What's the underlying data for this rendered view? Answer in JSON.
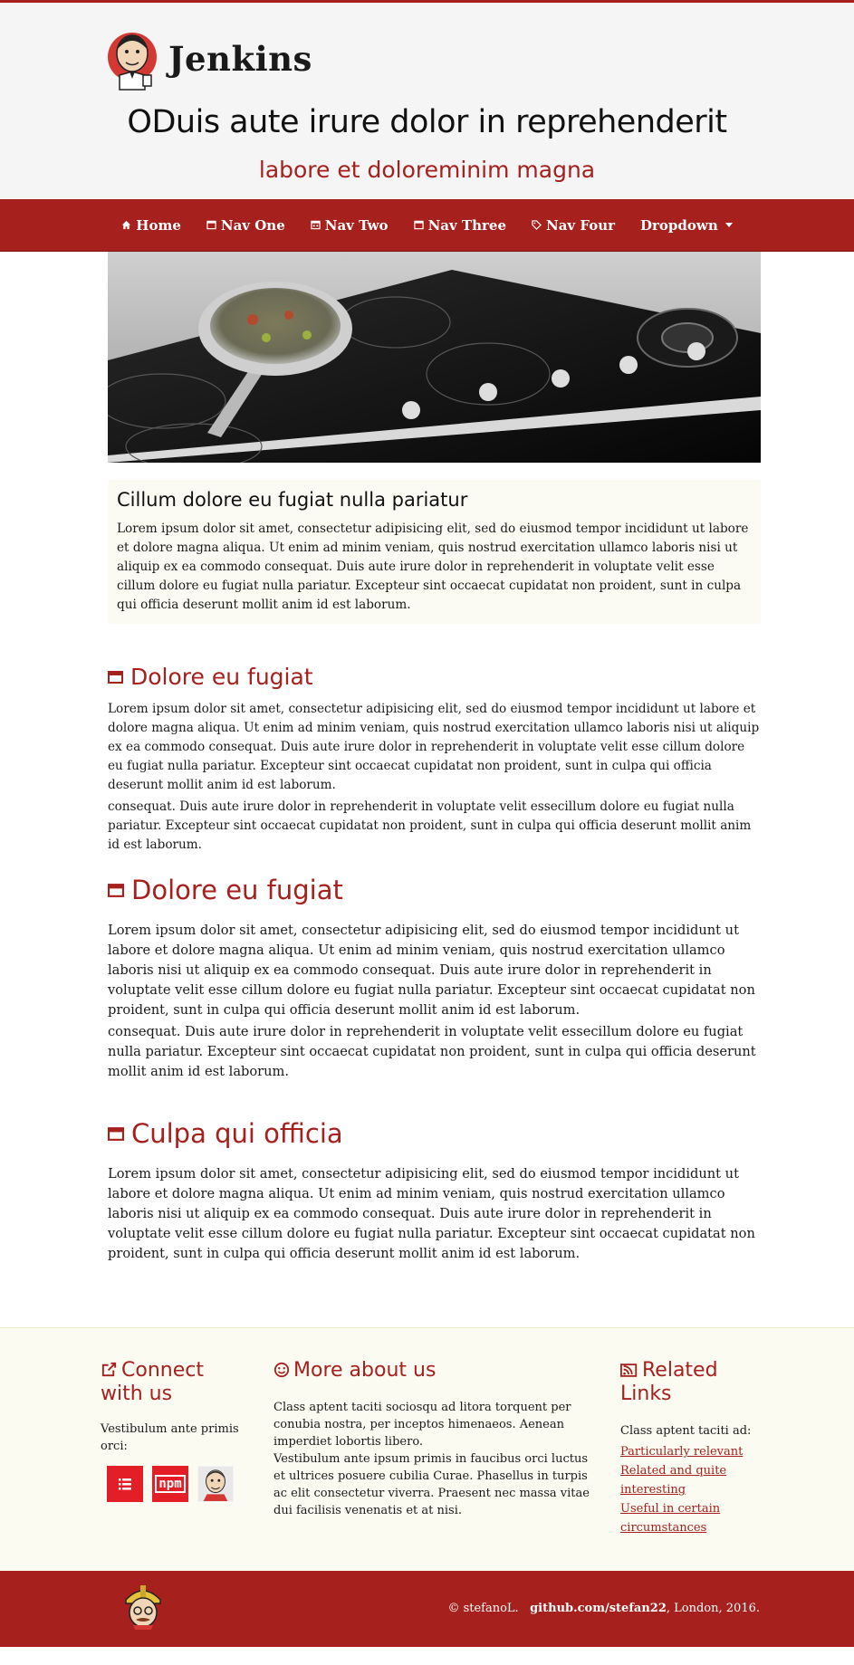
{
  "header": {
    "logo_text": "Jenkins",
    "title": "ODuis aute irure dolor in reprehenderit",
    "subtitle": "labore et doloreminim magna"
  },
  "nav": {
    "items": [
      {
        "label": "Home",
        "icon": "home-icon"
      },
      {
        "label": "Nav One",
        "icon": "window-icon"
      },
      {
        "label": "Nav Two",
        "icon": "calendar-icon"
      },
      {
        "label": "Nav Three",
        "icon": "window-icon"
      },
      {
        "label": "Nav Four",
        "icon": "tag-icon"
      },
      {
        "label": "Dropdown",
        "icon": "caret-down-icon"
      }
    ]
  },
  "intro": {
    "title": "Cillum dolore eu fugiat nulla pariatur",
    "text": "Lorem ipsum dolor sit amet, consectetur adipisicing elit, sed do eiusmod tempor incididunt ut labore et dolore magna aliqua. Ut enim ad minim veniam, quis nostrud exercitation ullamco laboris nisi ut aliquip ex ea commodo consequat. Duis aute irure dolor in reprehenderit in voluptate velit esse cillum dolore eu fugiat nulla pariatur. Excepteur sint occaecat cupidatat non proident, sunt in culpa qui officia deserunt mollit anim id est laborum."
  },
  "sections": [
    {
      "heading": "Dolore eu fugiat",
      "p1": "Lorem ipsum dolor sit amet, consectetur adipisicing elit, sed do eiusmod tempor incididunt ut labore et dolore magna aliqua. Ut enim ad minim veniam, quis nostrud exercitation ullamco laboris nisi ut aliquip ex ea commodo consequat. Duis aute irure dolor in reprehenderit in voluptate velit esse cillum dolore eu fugiat nulla pariatur. Excepteur sint occaecat cupidatat non proident, sunt in culpa qui officia deserunt mollit anim id est laborum.",
      "p2": "consequat. Duis aute irure dolor in reprehenderit in voluptate velit essecillum dolore eu fugiat nulla pariatur. Excepteur sint occaecat cupidatat non proident, sunt in culpa qui officia deserunt mollit anim id est laborum."
    },
    {
      "heading": "Dolore eu fugiat",
      "p1": "Lorem ipsum dolor sit amet, consectetur adipisicing elit, sed do eiusmod tempor incididunt ut labore et dolore magna aliqua. Ut enim ad minim veniam, quis nostrud exercitation ullamco laboris nisi ut aliquip ex ea commodo consequat. Duis aute irure dolor in reprehenderit in voluptate velit esse cillum dolore eu fugiat nulla pariatur. Excepteur sint occaecat cupidatat non proident, sunt in culpa qui officia deserunt mollit anim id est laborum.",
      "p2": "consequat. Duis aute irure dolor in reprehenderit in voluptate velit essecillum dolore eu fugiat nulla pariatur. Excepteur sint occaecat cupidatat non proident, sunt in culpa qui officia deserunt mollit anim id est laborum."
    },
    {
      "heading": "Culpa qui officia",
      "p1": "Lorem ipsum dolor sit amet, consectetur adipisicing elit, sed do eiusmod tempor incididunt ut labore et dolore magna aliqua. Ut enim ad minim veniam, quis nostrud exercitation ullamco laboris nisi ut aliquip ex ea commodo consequat. Duis aute irure dolor in reprehenderit in voluptate velit esse cillum dolore eu fugiat nulla pariatur. Excepteur sint occaecat cupidatat non proident, sunt in culpa qui officia deserunt mollit anim id est laborum."
    }
  ],
  "footer": {
    "connect": {
      "heading": "Connect with us",
      "text": "Vestibulum ante primis orci:",
      "icons": [
        "list-icon",
        "npm-icon",
        "jenkins-avatar-icon"
      ],
      "npm_label": "npm"
    },
    "about": {
      "heading": "More about us",
      "text1": "Class aptent taciti sociosqu ad litora torquent per conubia nostra, per inceptos himenaeos. Aenean imperdiet lobortis libero.",
      "text2": "Vestibulum ante ipsum primis in faucibus orci luctus et ultrices posuere cubilia Curae. Phasellus in turpis ac elit consectetur viverra. Praesent nec massa vitae dui facilisis venenatis et at nisi."
    },
    "related": {
      "heading": "Related Links",
      "text": "Class aptent taciti ad:",
      "links": [
        "Particularly relevant",
        "Related and quite interesting",
        "Useful in certain circumstances"
      ]
    }
  },
  "bottom": {
    "copyright_prefix": "© stefanoL.",
    "github_link": "github.com/stefan22",
    "copyright_suffix": ", London, 2016."
  },
  "colors": {
    "brand_red": "#a6201d",
    "header_bg": "#f5f5f5",
    "footer_bg": "#fbfbf2",
    "social_red": "#e41e26"
  }
}
